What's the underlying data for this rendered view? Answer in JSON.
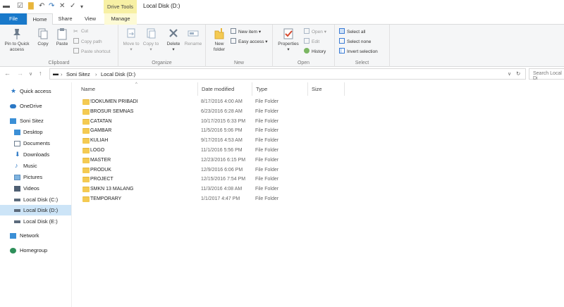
{
  "window": {
    "title": "Local Disk (D:)",
    "context_group": "Drive Tools"
  },
  "tabs": [
    "File",
    "Home",
    "Share",
    "View",
    "Manage"
  ],
  "ribbon": {
    "clipboard": {
      "label": "Clipboard",
      "pin": "Pin to Quick access",
      "copy": "Copy",
      "paste": "Paste",
      "cut": "Cut",
      "copy_path": "Copy path",
      "paste_shortcut": "Paste shortcut"
    },
    "organize": {
      "label": "Organize",
      "move_to": "Move to",
      "copy_to": "Copy to",
      "delete": "Delete",
      "rename": "Rename"
    },
    "new": {
      "label": "New",
      "new_folder": "New folder",
      "new_item": "New item",
      "easy_access": "Easy access"
    },
    "open": {
      "label": "Open",
      "properties": "Properties",
      "open": "Open",
      "edit": "Edit",
      "history": "History"
    },
    "select": {
      "label": "Select",
      "select_all": "Select all",
      "select_none": "Select none",
      "invert": "Invert selection"
    }
  },
  "address": {
    "crumbs": [
      "Soni Sitez",
      "Local Disk (D:)"
    ],
    "search_placeholder": "Search Local Di"
  },
  "nav": [
    {
      "label": "Quick access",
      "icon": "star-icon"
    },
    {
      "label": "OneDrive",
      "icon": "cloud-icon"
    },
    {
      "label": "Soni Sitez",
      "icon": "computer-icon"
    },
    {
      "label": "Desktop",
      "icon": "desktop-icon"
    },
    {
      "label": "Documents",
      "icon": "documents-icon"
    },
    {
      "label": "Downloads",
      "icon": "downloads-icon"
    },
    {
      "label": "Music",
      "icon": "music-icon"
    },
    {
      "label": "Pictures",
      "icon": "pictures-icon"
    },
    {
      "label": "Videos",
      "icon": "videos-icon"
    },
    {
      "label": "Local Disk (C:)",
      "icon": "drive-icon"
    },
    {
      "label": "Local Disk (D:)",
      "icon": "drive-icon",
      "selected": true
    },
    {
      "label": "Local Disk (E:)",
      "icon": "drive-icon"
    },
    {
      "label": "Network",
      "icon": "network-icon"
    },
    {
      "label": "Homegroup",
      "icon": "homegroup-icon"
    }
  ],
  "columns": [
    "Name",
    "Date modified",
    "Type",
    "Size"
  ],
  "files": [
    {
      "name": "!DOKUMEN PRIBADI",
      "date": "8/17/2016 4:00 AM",
      "type": "File Folder"
    },
    {
      "name": "BROSUR SEMNAS",
      "date": "6/23/2016 6:28 AM",
      "type": "File Folder"
    },
    {
      "name": "CATATAN",
      "date": "10/17/2015 6:33 PM",
      "type": "File Folder"
    },
    {
      "name": "GAMBAR",
      "date": "11/5/2016 5:06 PM",
      "type": "File Folder"
    },
    {
      "name": "KULIAH",
      "date": "9/17/2016 4:53 AM",
      "type": "File Folder"
    },
    {
      "name": "LOGO",
      "date": "11/1/2016 5:56 PM",
      "type": "File Folder"
    },
    {
      "name": "MASTER",
      "date": "12/23/2016 6:15 PM",
      "type": "File Folder"
    },
    {
      "name": "PRODUK",
      "date": "12/9/2016 6:06 PM",
      "type": "File Folder"
    },
    {
      "name": "PROJECT",
      "date": "12/15/2016 7:54 PM",
      "type": "File Folder"
    },
    {
      "name": "SMKN 13 MALANG",
      "date": "11/3/2016 4:08 AM",
      "type": "File Folder"
    },
    {
      "name": "TEMPORARY",
      "date": "1/1/2017 4:47 PM",
      "type": "File Folder"
    }
  ]
}
